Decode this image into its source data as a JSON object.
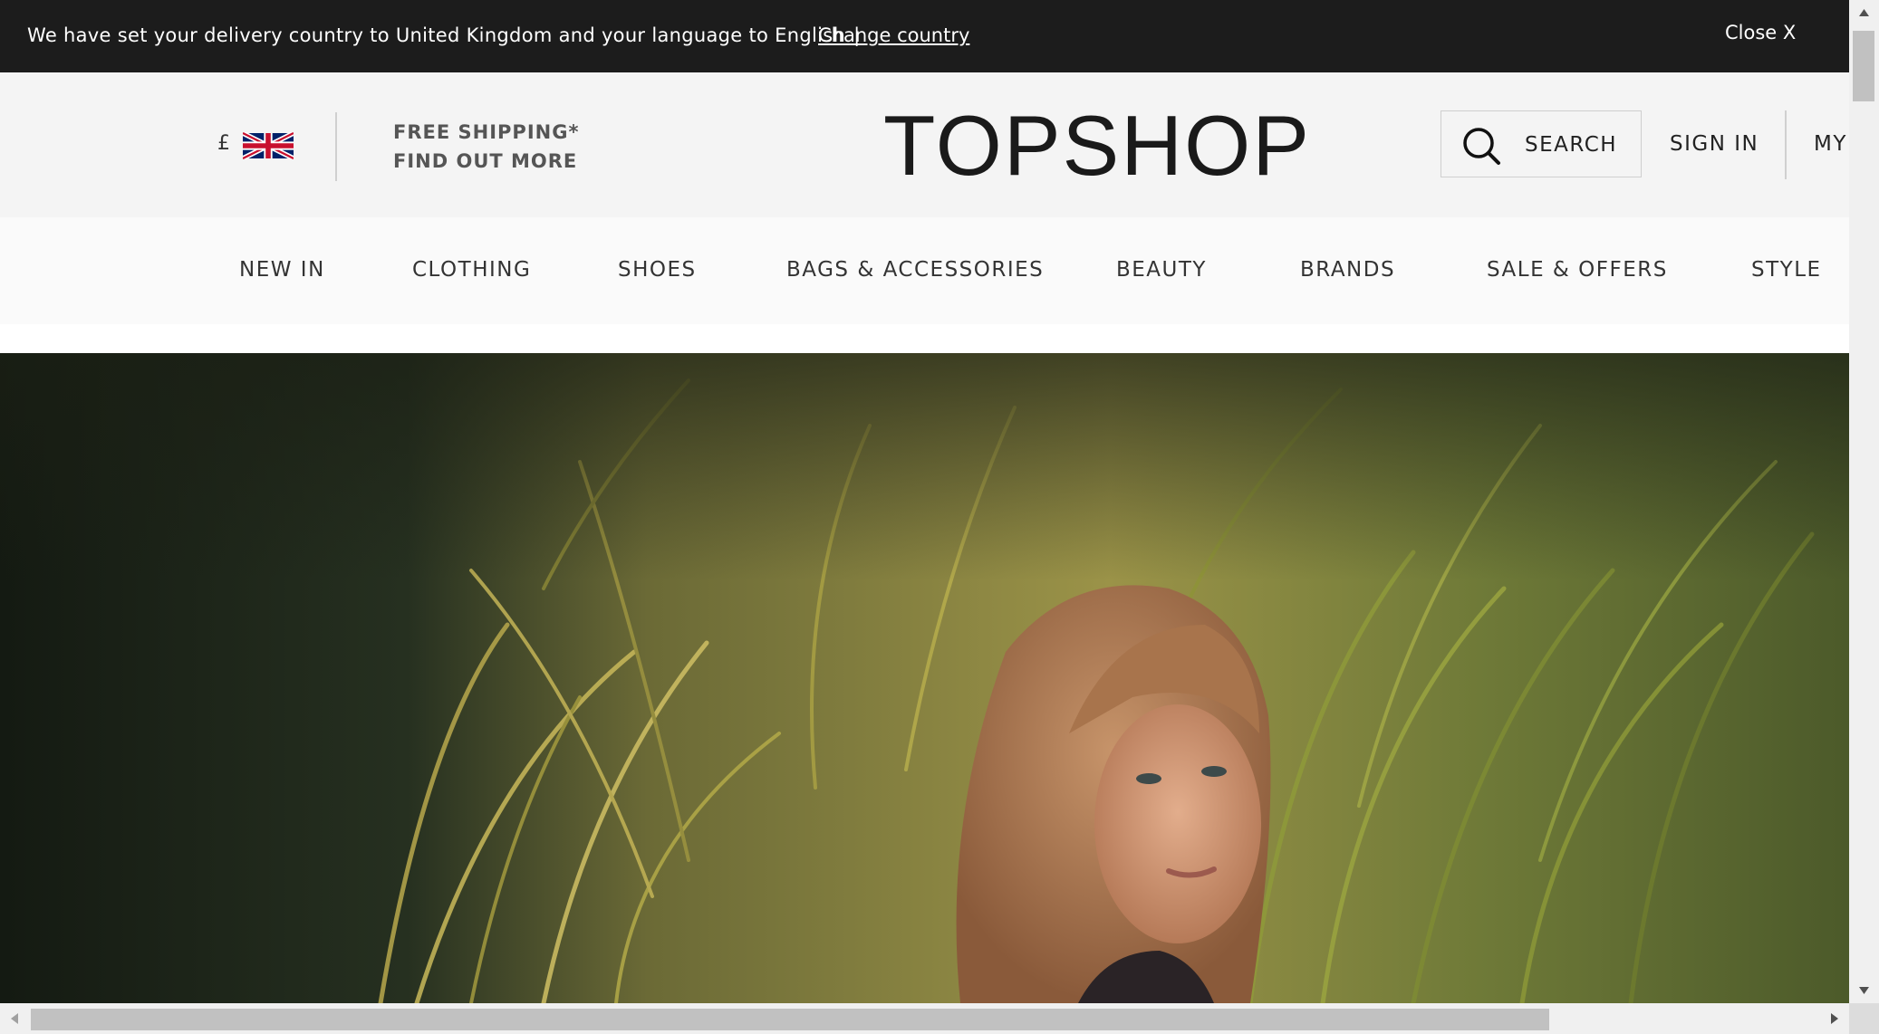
{
  "banner": {
    "message": "We have set your delivery country to United Kingdom and your language to English",
    "separator": "|",
    "change_link": "Change country",
    "close_label": "Close X"
  },
  "header": {
    "currency_symbol": "£",
    "promo_line1": "FREE SHIPPING*",
    "promo_line2": "FIND OUT MORE",
    "logo": "TOPSHOP",
    "search_label": "SEARCH",
    "signin_label": "SIGN IN",
    "account_label": "MY"
  },
  "nav": {
    "items": [
      {
        "label": "NEW IN"
      },
      {
        "label": "CLOTHING"
      },
      {
        "label": "SHOES"
      },
      {
        "label": "BAGS & ACCESSORIES"
      },
      {
        "label": "BEAUTY"
      },
      {
        "label": "BRANDS"
      },
      {
        "label": "SALE & OFFERS"
      },
      {
        "label": "STYLE"
      }
    ]
  },
  "colors": {
    "banner_bg": "#1c1c1c",
    "header_bg": "#f4f4f4",
    "nav_bg": "#fafafa",
    "text": "#222222"
  },
  "icons": [
    "uk-flag-icon",
    "search-icon",
    "scroll-up-arrow-icon",
    "scroll-down-arrow-icon",
    "scroll-left-arrow-icon",
    "scroll-right-arrow-icon"
  ]
}
